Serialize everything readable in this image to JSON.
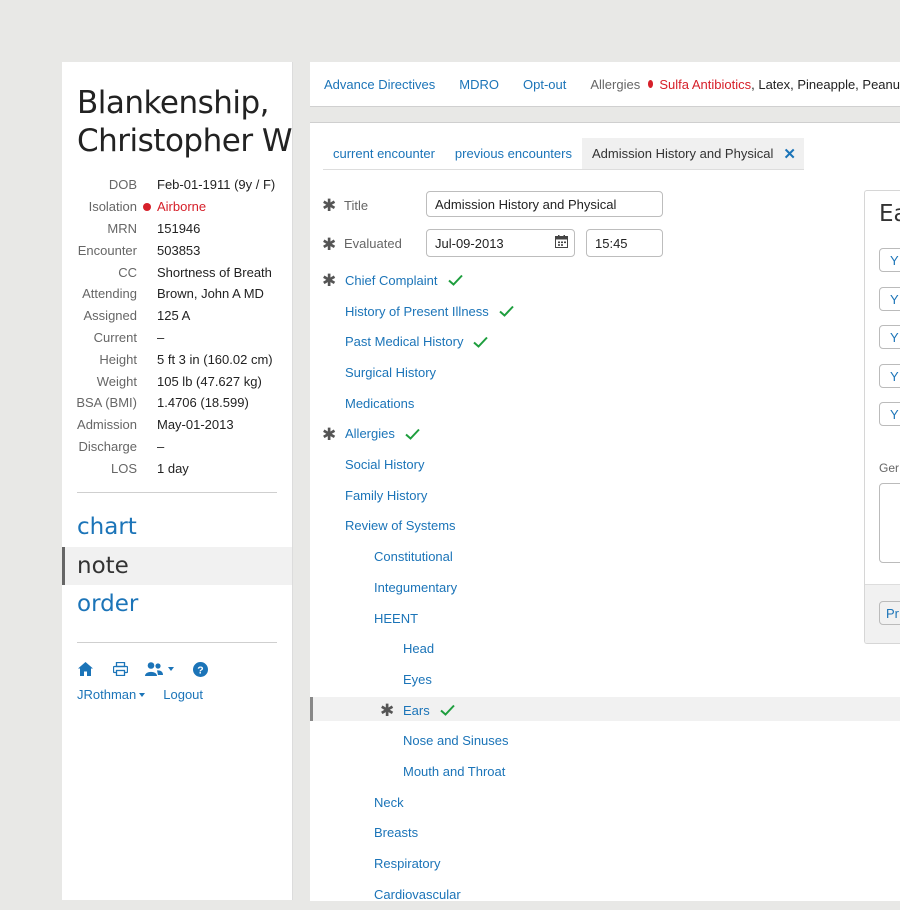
{
  "patient": {
    "name_line1": "Blankenship,",
    "name_line2": "Christopher W",
    "demographics": [
      {
        "label": "DOB",
        "value": "Feb-01-1911 (9y / F)"
      },
      {
        "label": "Isolation",
        "value": "Airborne",
        "alert": true
      },
      {
        "label": "MRN",
        "value": "151946"
      },
      {
        "label": "Encounter",
        "value": "503853"
      },
      {
        "label": "CC",
        "value": "Shortness of Breath"
      },
      {
        "label": "Attending",
        "value": "Brown, John A MD"
      },
      {
        "label": "Assigned",
        "value": "125 A"
      },
      {
        "label": "Current",
        "value": "–"
      },
      {
        "label": "Height",
        "value": "5 ft 3 in (160.02 cm)"
      },
      {
        "label": "Weight",
        "value": "105 lb (47.627 kg)"
      },
      {
        "label": "BSA (BMI)",
        "value": "1.4706 (18.599)"
      },
      {
        "label": "Admission",
        "value": "May-01-2013"
      },
      {
        "label": "Discharge",
        "value": "–"
      },
      {
        "label": "LOS",
        "value": "1 day"
      }
    ]
  },
  "main_nav": [
    {
      "label": "chart",
      "active": false
    },
    {
      "label": "note",
      "active": true
    },
    {
      "label": "order",
      "active": false
    }
  ],
  "utility": {
    "icons": [
      "home-icon",
      "print-icon",
      "users-icon",
      "help-icon"
    ],
    "user_label": "JRothman",
    "logout_label": "Logout"
  },
  "topbar": {
    "links": [
      "Advance Directives",
      "MDRO",
      "Opt-out"
    ],
    "allergies_label": "Allergies",
    "allergies": [
      {
        "text": "Sulfa Antibiotics",
        "alert": true
      },
      {
        "text": ", Latex, Pineapple, Peanu",
        "alert": false
      }
    ]
  },
  "tabs": [
    {
      "label": "current encounter",
      "active": false
    },
    {
      "label": "previous encounters",
      "active": false
    },
    {
      "label": "Admission History and Physical",
      "active": true
    }
  ],
  "form": {
    "title_label": "Title",
    "title_value": "Admission History and Physical",
    "evaluated_label": "Evaluated",
    "date_value": "Jul-09-2013",
    "time_value": "15:45"
  },
  "sections": [
    {
      "label": "Chief Complaint",
      "level": 0,
      "required": true,
      "done": true
    },
    {
      "label": "History of Present Illness",
      "level": 0,
      "required": false,
      "done": true
    },
    {
      "label": "Past Medical History",
      "level": 0,
      "required": false,
      "done": true
    },
    {
      "label": "Surgical History",
      "level": 0,
      "required": false,
      "done": false
    },
    {
      "label": "Medications",
      "level": 0,
      "required": false,
      "done": false
    },
    {
      "label": "Allergies",
      "level": 0,
      "required": true,
      "done": true
    },
    {
      "label": "Social History",
      "level": 0,
      "required": false,
      "done": false
    },
    {
      "label": "Family History",
      "level": 0,
      "required": false,
      "done": false
    },
    {
      "label": "Review of Systems",
      "level": 0,
      "required": false,
      "done": false
    },
    {
      "label": "Constitutional",
      "level": 1,
      "required": false,
      "done": false
    },
    {
      "label": "Integumentary",
      "level": 1,
      "required": false,
      "done": false
    },
    {
      "label": "HEENT",
      "level": 1,
      "required": false,
      "done": false
    },
    {
      "label": "Head",
      "level": 2,
      "required": false,
      "done": false
    },
    {
      "label": "Eyes",
      "level": 2,
      "required": false,
      "done": false
    },
    {
      "label": "Ears",
      "level": 2,
      "required": true,
      "done": true,
      "selected": true
    },
    {
      "label": "Nose and Sinuses",
      "level": 2,
      "required": false,
      "done": false
    },
    {
      "label": "Mouth and Throat",
      "level": 2,
      "required": false,
      "done": false
    },
    {
      "label": "Neck",
      "level": 1,
      "required": false,
      "done": false
    },
    {
      "label": "Breasts",
      "level": 1,
      "required": false,
      "done": false
    },
    {
      "label": "Respiratory",
      "level": 1,
      "required": false,
      "done": false
    },
    {
      "label": "Cardiovascular",
      "level": 1,
      "required": false,
      "done": false
    }
  ],
  "subpanel": {
    "title": "Ea",
    "buttons": [
      "Y",
      "Y",
      "Y",
      "Y",
      "Y"
    ],
    "general_label": "Ger",
    "footer_button": "Pr"
  },
  "colors": {
    "link": "#1b74b8",
    "alert": "#d6202a",
    "check": "#1e9e3e"
  }
}
